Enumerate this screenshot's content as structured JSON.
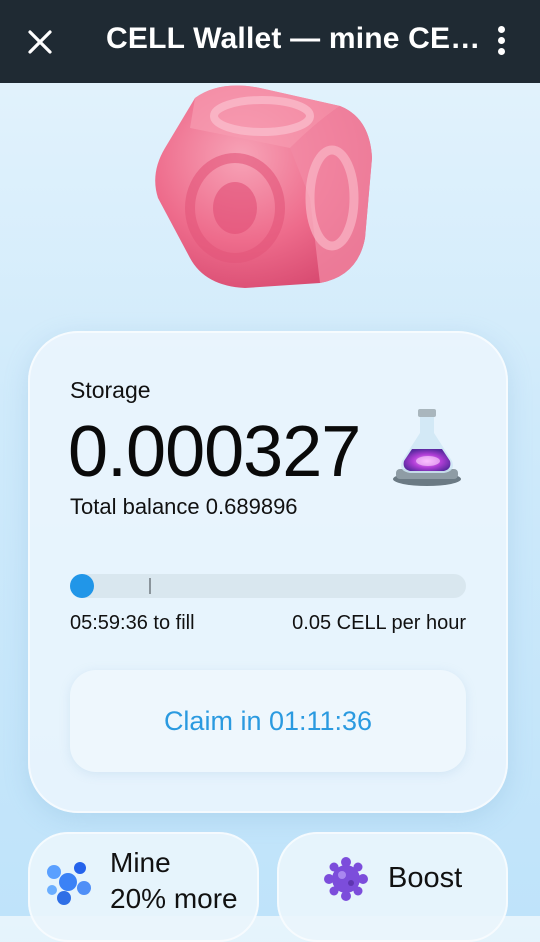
{
  "header": {
    "title": "CELL Wallet — mine CE…"
  },
  "storage": {
    "label": "Storage",
    "value": "0.000327",
    "balance_label": "Total balance",
    "balance_value": "0.689896"
  },
  "progress": {
    "fraction": 0.05,
    "time_to_fill": "05:59:36 to fill",
    "rate": "0.05 CELL per hour"
  },
  "claim": {
    "label": "Claim in 01:11:36"
  },
  "tiles": {
    "mine_line1": "Mine",
    "mine_line2": "20% more",
    "boost_label": "Boost"
  },
  "colors": {
    "accent": "#2196e8",
    "header_bg": "#1f2a33",
    "cube": "#ef6a8a"
  }
}
